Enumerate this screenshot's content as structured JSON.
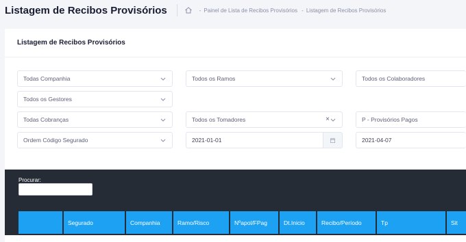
{
  "header": {
    "title": "Listagem de Recibos Provisórios",
    "breadcrumb": [
      "Painel de Lista de Recibos Provisórios",
      "Listagem de Recibos Provisórios"
    ]
  },
  "card": {
    "title": "Listagem de Recibos Provisórios"
  },
  "filters": {
    "companhia": "Todas Companhia",
    "ramos": "Todos os Ramos",
    "colaboradores": "Todos os Colaboradores",
    "gestores": "Todos os Gestores",
    "cobrancas": "Todas Cobranças",
    "tomadores": "Todos os Tomadores",
    "estado": "P - Provisórios Pagos",
    "ordem": "Ordem Código Segurado",
    "data_inicio": "2021-01-01",
    "data_fim": "2021-04-07"
  },
  "table": {
    "search_label": "Procurar:",
    "search_value": "",
    "columns": [
      "",
      "Segurado",
      "Companhia",
      "Ramo/Risco",
      "Nºapol/FPag",
      "Dt.Inicio",
      "Recibo/Período",
      "Tp",
      "Sit"
    ]
  },
  "colors": {
    "accent": "#1da1f2",
    "dark_panel": "#262c35"
  }
}
